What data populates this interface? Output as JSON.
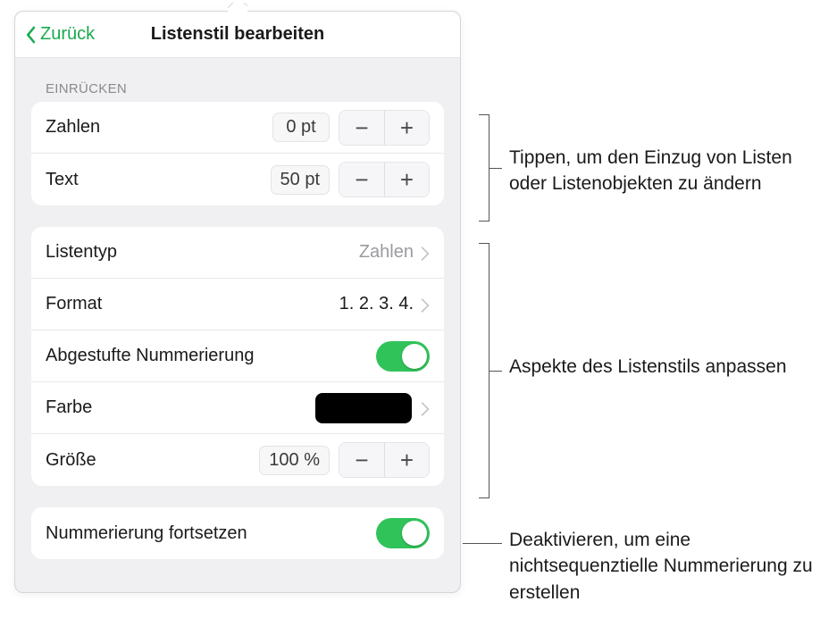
{
  "header": {
    "back_label": "Zurück",
    "title": "Listenstil bearbeiten"
  },
  "indent_section": {
    "heading": "EINRÜCKEN",
    "rows": {
      "numbers": {
        "label": "Zahlen",
        "value": "0 pt"
      },
      "text": {
        "label": "Text",
        "value": "50 pt"
      }
    }
  },
  "style_section": {
    "listtype": {
      "label": "Listentyp",
      "value": "Zahlen"
    },
    "format": {
      "label": "Format",
      "value": "1. 2. 3. 4."
    },
    "tiered": {
      "label": "Abgestufte Nummerierung",
      "on": true
    },
    "color": {
      "label": "Farbe",
      "swatch": "#000000"
    },
    "size": {
      "label": "Größe",
      "value": "100 %"
    }
  },
  "continue_section": {
    "continue": {
      "label": "Nummerierung fortsetzen",
      "on": true
    }
  },
  "annotations": {
    "a1": "Tippen, um den Einzug von Listen oder Listenobjekten zu ändern",
    "a2": "Aspekte des Listenstils anpassen",
    "a3": "Deaktivieren, um eine nichtsequenztielle Nummerierung zu erstellen"
  }
}
